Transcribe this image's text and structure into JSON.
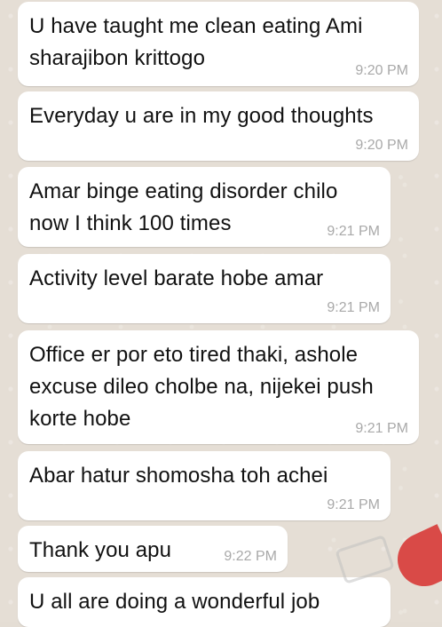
{
  "messages": [
    {
      "text": "U have taught me clean eating Ami sharajibon krittogo",
      "time": "9:20 PM"
    },
    {
      "text": "Everyday u are in my good thoughts",
      "time": "9:20 PM"
    },
    {
      "text": "Amar binge eating disorder chilo now I think 100 times",
      "time": "9:21 PM"
    },
    {
      "text": "Activity level barate hobe amar",
      "time": "9:21 PM"
    },
    {
      "text": "Office er por eto tired thaki, ashole excuse dileo cholbe na, nijekei push korte hobe",
      "time": "9:21 PM"
    },
    {
      "text": "Abar hatur shomosha toh achei",
      "time": "9:21 PM"
    },
    {
      "text": "Thank you apu",
      "time": "9:22 PM"
    },
    {
      "text": "U all are doing a wonderful job",
      "time": ""
    }
  ]
}
